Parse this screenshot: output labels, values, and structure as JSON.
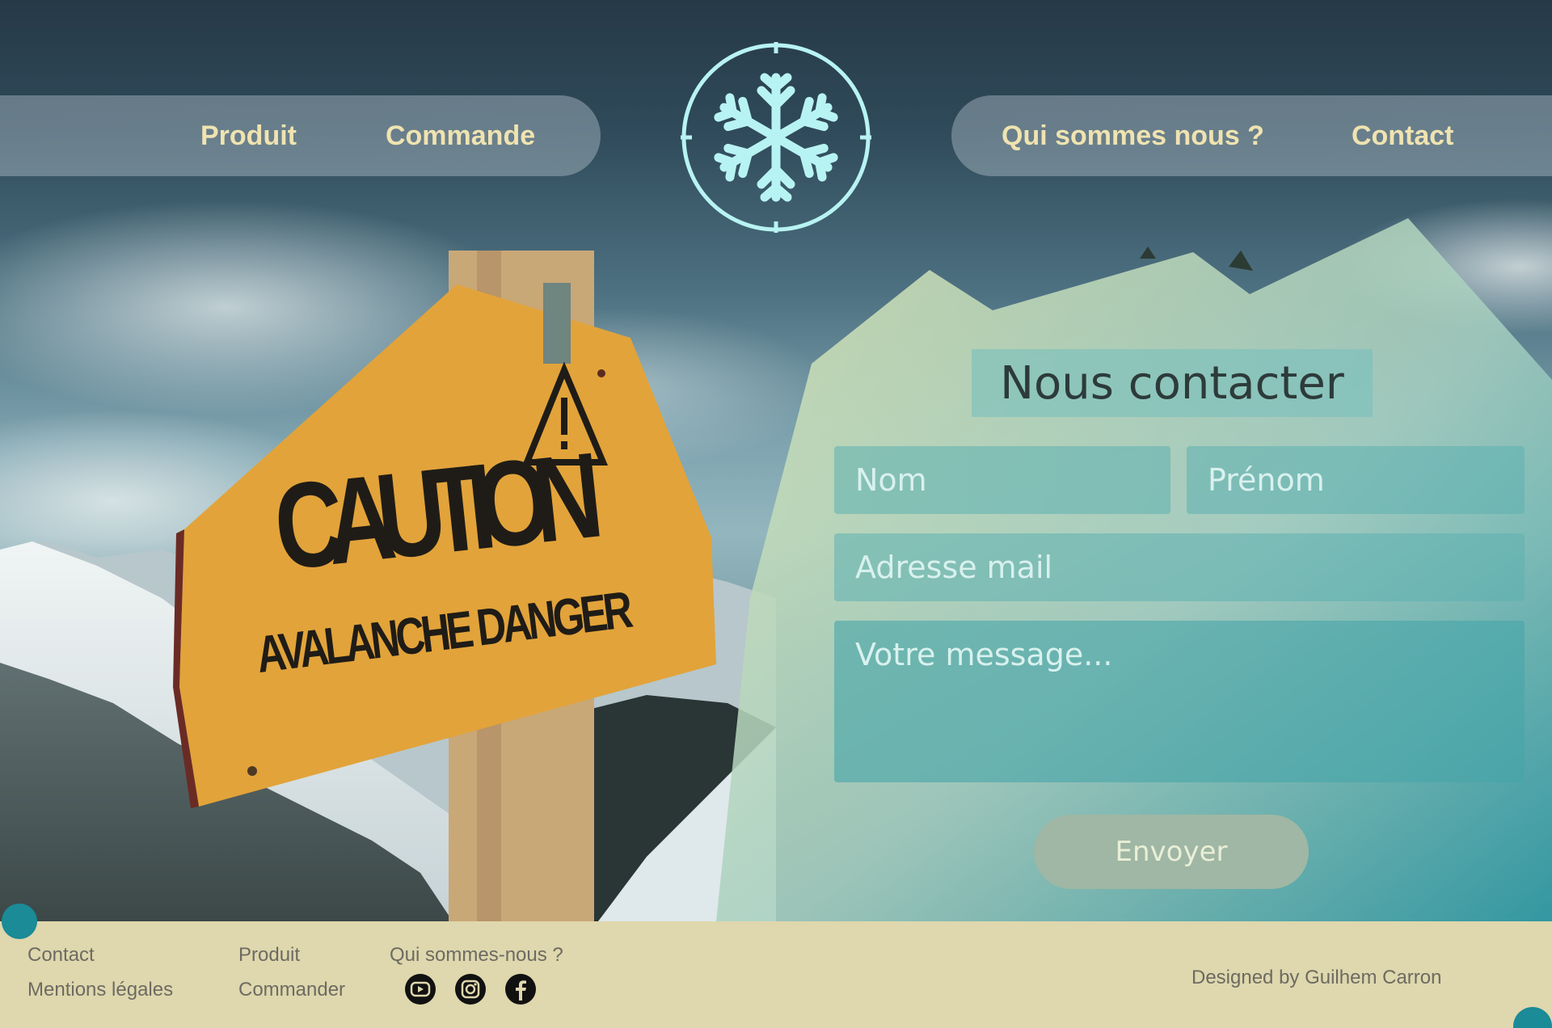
{
  "nav": {
    "left": [
      "Produit",
      "Commande"
    ],
    "right": [
      "Qui sommes nous ?",
      "Contact"
    ]
  },
  "logo_icon": "snowflake-icon",
  "sign": {
    "headline": "CAUTION",
    "subline": "AVALANCHE DANGER",
    "icon": "warning-triangle-icon"
  },
  "form": {
    "title": "Nous contacter",
    "nom_placeholder": "Nom",
    "prenom_placeholder": "Prénom",
    "mail_placeholder": "Adresse mail",
    "message_placeholder": "Votre message...",
    "submit": "Envoyer"
  },
  "footer": {
    "col1": [
      "Contact",
      "Mentions légales"
    ],
    "col2": [
      "Produit",
      "Commander"
    ],
    "col3_title": "Qui sommes-nous ?",
    "social": [
      "youtube-icon",
      "instagram-icon",
      "facebook-icon"
    ],
    "credit": "Designed by Guilhem Carron"
  },
  "colors": {
    "accent": "#b8f3f3",
    "nav_text": "#efe3b0",
    "footer_bg": "#dfd7ad",
    "button": "#9fb7a4",
    "teal_dot": "#1a8b97",
    "sign": "#e2a33a"
  }
}
